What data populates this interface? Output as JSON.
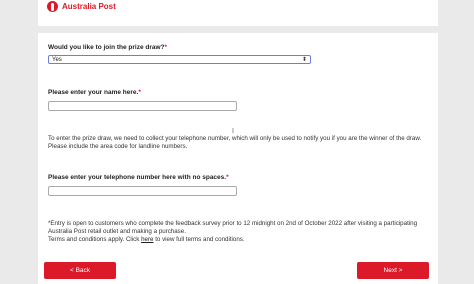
{
  "brand": {
    "name": "Australia Post",
    "color": "#dc1928"
  },
  "form": {
    "prize_question": "Would you like to join the prize draw?",
    "prize_selected": "Yes",
    "name_label": "Please enter your name here.",
    "info_text": "To enter the prize draw, we need to collect your telephone number, which will only be used to notify you if you are the winner of the draw. Please include the area code for landline numbers.",
    "phone_label": "Please enter your telephone number here with no spaces.",
    "required_mark": "*",
    "terms_line1": "*Entry is open to customers who complete the feedback survey prior to 12 midnight on 2nd of October 2022 after visiting a participating Australia Post retail outlet and making a purchase.",
    "terms_line2_pre": "Terms and conditions apply. Click ",
    "terms_link": "here",
    "terms_line2_post": " to view full terms and conditions."
  },
  "buttons": {
    "back": "< Back",
    "next": "Next >"
  }
}
